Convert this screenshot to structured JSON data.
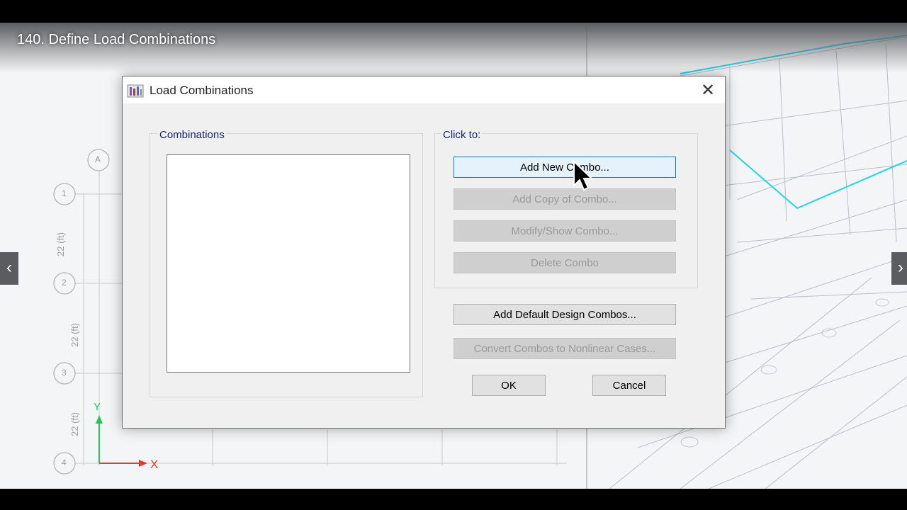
{
  "video": {
    "title": "140. Define Load Combinations",
    "nav_prev": "‹",
    "nav_next": "›"
  },
  "background": {
    "grid_labels": [
      "A",
      "1",
      "2",
      "3",
      "4"
    ],
    "dim_labels": [
      "22 (ft)",
      "22 (ft)",
      "22 (ft)"
    ],
    "axis_y": "Y",
    "axis_x": "X",
    "colors": {
      "axis_y": "#22c55e",
      "axis_x": "#e53935",
      "highlight": "#22d3ee"
    }
  },
  "dialog": {
    "title": "Load Combinations",
    "app_icon": "etabs-app-icon",
    "close": "✕",
    "combinations_label": "Combinations",
    "combinations_items": [],
    "clickto_label": "Click to:",
    "buttons": {
      "add_new": "Add New Combo...",
      "add_copy": "Add Copy of Combo...",
      "modify": "Modify/Show Combo...",
      "delete": "Delete Combo",
      "add_default": "Add Default Design Combos...",
      "convert": "Convert Combos to Nonlinear Cases...",
      "ok": "OK",
      "cancel": "Cancel"
    },
    "colors": {
      "label": "#1a237e",
      "focus_border": "#0078d7"
    }
  }
}
